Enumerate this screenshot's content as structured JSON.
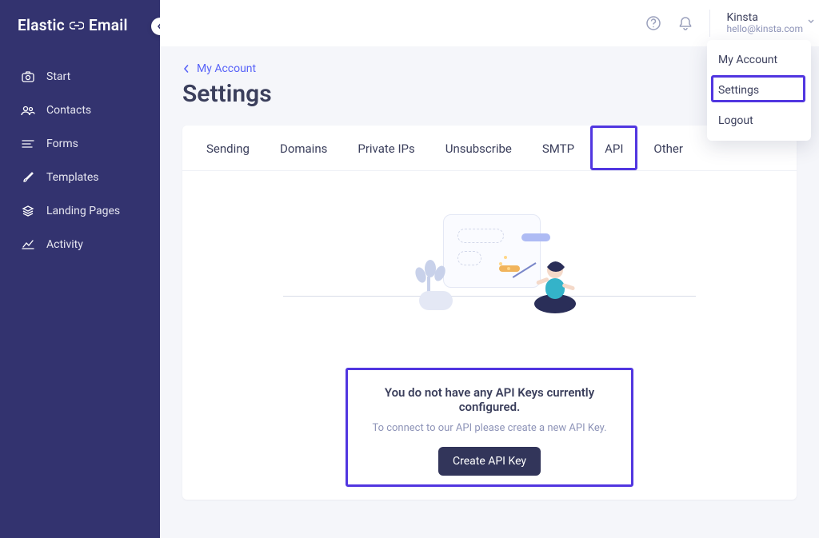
{
  "logo": {
    "part1": "Elastic",
    "part2": "Email"
  },
  "sidebar": {
    "items": [
      {
        "label": "Start"
      },
      {
        "label": "Contacts"
      },
      {
        "label": "Forms"
      },
      {
        "label": "Templates"
      },
      {
        "label": "Landing Pages"
      },
      {
        "label": "Activity"
      }
    ]
  },
  "user": {
    "name": "Kinsta",
    "email": "hello@kinsta.com"
  },
  "dropdown": {
    "items": [
      {
        "label": "My Account"
      },
      {
        "label": "Settings"
      },
      {
        "label": "Logout"
      }
    ]
  },
  "breadcrumb": {
    "label": "My Account"
  },
  "page_title": "Settings",
  "tabs": [
    {
      "label": "Sending"
    },
    {
      "label": "Domains"
    },
    {
      "label": "Private IPs"
    },
    {
      "label": "Unsubscribe"
    },
    {
      "label": "SMTP"
    },
    {
      "label": "API"
    },
    {
      "label": "Other"
    }
  ],
  "panel": {
    "headline": "You do not have any API Keys currently configured.",
    "sub": "To connect to our API please create a new API Key.",
    "cta": "Create API Key"
  }
}
